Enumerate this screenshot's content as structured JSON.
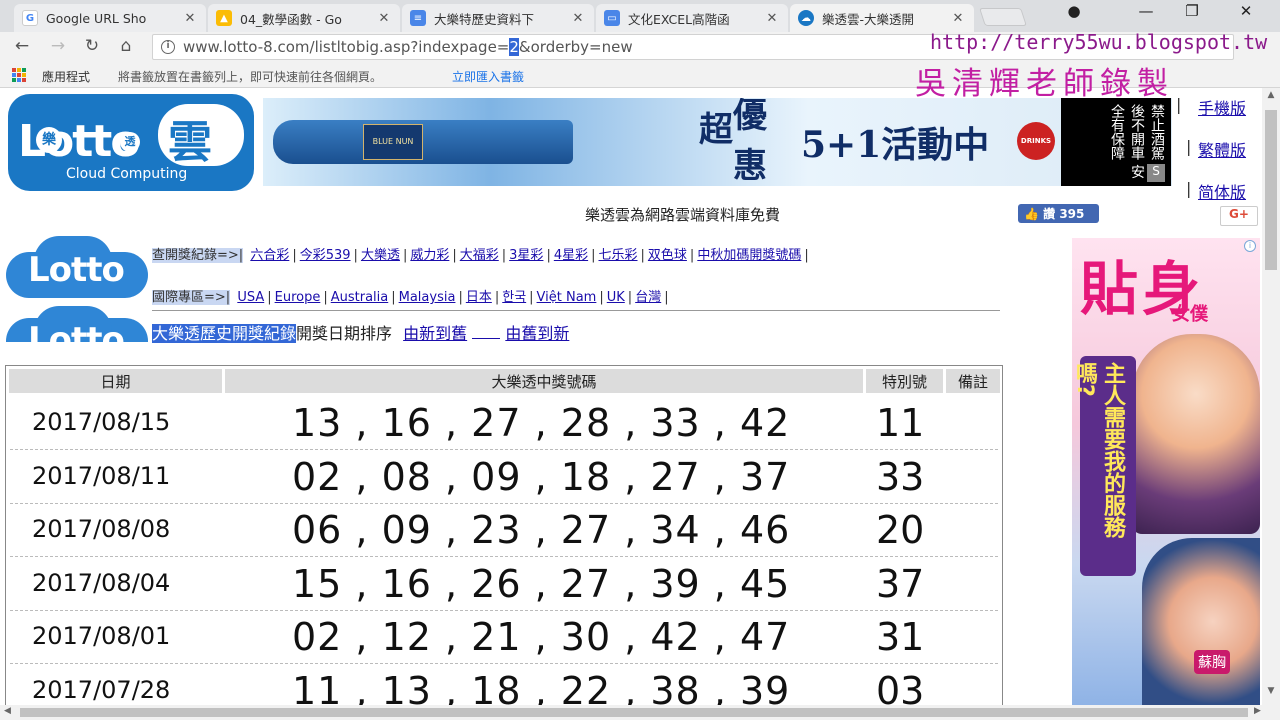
{
  "browser": {
    "tabs": [
      {
        "title": "Google URL Sho",
        "icon": "google-icon",
        "color": "#4285f4",
        "active": false
      },
      {
        "title": "04_數學函數 - Go",
        "icon": "drive-icon",
        "color": "#34a853",
        "active": false
      },
      {
        "title": "大樂特歷史資料下",
        "icon": "docs-icon",
        "color": "#4a86e8",
        "active": false
      },
      {
        "title": "文化EXCEL高階函",
        "icon": "slides-icon",
        "color": "#4a86e8",
        "active": false
      },
      {
        "title": "樂透雲-大樂透開",
        "icon": "lotto-icon",
        "color": "#1a77c4",
        "active": true
      }
    ],
    "url_prefix": "www.lotto-8.com/listltobig.asp?indexpage=",
    "url_selected": "2",
    "url_suffix": "&orderby=new",
    "bookmarks_apps": "應用程式",
    "bookmarks_hint": "將書籤放置在書籤列上，即可快速前往各個網頁。",
    "bookmarks_import": "立即匯入書籤"
  },
  "watermark": {
    "blog": "http://terry55wu.blogspot.tw",
    "author": "吳清輝老師錄製"
  },
  "site": {
    "logo_word": "Lotto",
    "logo_cloud": "雲",
    "logo_badge1": "樂",
    "logo_badge2": "透",
    "logo_sub": "Cloud Computing",
    "banner_label": "BLUE NUN",
    "banner_promo_a": "超",
    "banner_promo_b": "優",
    "banner_promo_c": "惠",
    "banner_promo_main": "5+1活動中",
    "banner_logo": "DRINKS",
    "banner_warning": "禁止酒駕 酒後不開車 安全有保障",
    "banner_corner": "S",
    "right_links": [
      "手機版",
      "繁體版",
      "简体版"
    ],
    "free_text": "樂透雲為網路雲端資料庫免費",
    "fb_label": "讚 395",
    "gplus_label": "G+"
  },
  "nav": {
    "query_label": "查開獎紀錄=>|",
    "query_links": [
      "六合彩",
      "今彩539",
      "大樂透",
      "威力彩",
      "大福彩",
      "3星彩",
      "4星彩",
      "七乐彩",
      "双色球",
      "中秋加碼開獎號碼"
    ],
    "intl_label": "國際專區=>|",
    "intl_links": [
      "USA",
      "Europe",
      "Australia",
      "Malaysia",
      "日本",
      "한국",
      "Việt Nam",
      "UK",
      "台灣"
    ]
  },
  "sort": {
    "title": "大樂透歷史開獎紀錄",
    "label": "開獎日期排序",
    "newest": "由新到舊",
    "oldest": "由舊到新"
  },
  "table": {
    "headers": [
      "日期",
      "大樂透中獎號碼",
      "特別號",
      "備註"
    ],
    "rows": [
      {
        "date": "2017/08/15",
        "numbers": "13 , 16 , 27 , 28 , 33 , 42",
        "special": "11"
      },
      {
        "date": "2017/08/11",
        "numbers": "02 , 08 , 09 , 18 , 27 , 37",
        "special": "33"
      },
      {
        "date": "2017/08/08",
        "numbers": "06 , 09 , 23 , 27 , 34 , 46",
        "special": "20"
      },
      {
        "date": "2017/08/04",
        "numbers": "15 , 16 , 26 , 27 , 39 , 45",
        "special": "37"
      },
      {
        "date": "2017/08/01",
        "numbers": "02 , 12 , 21 , 30 , 42 , 47",
        "special": "31"
      },
      {
        "date": "2017/07/28",
        "numbers": "11 , 13 , 18 , 22 , 38 , 39",
        "special": "03"
      }
    ]
  },
  "ad": {
    "headline": "貼身",
    "sub": "女僕",
    "vertical": "主人需要我的服務嗎?",
    "tag": "蘇胸"
  }
}
